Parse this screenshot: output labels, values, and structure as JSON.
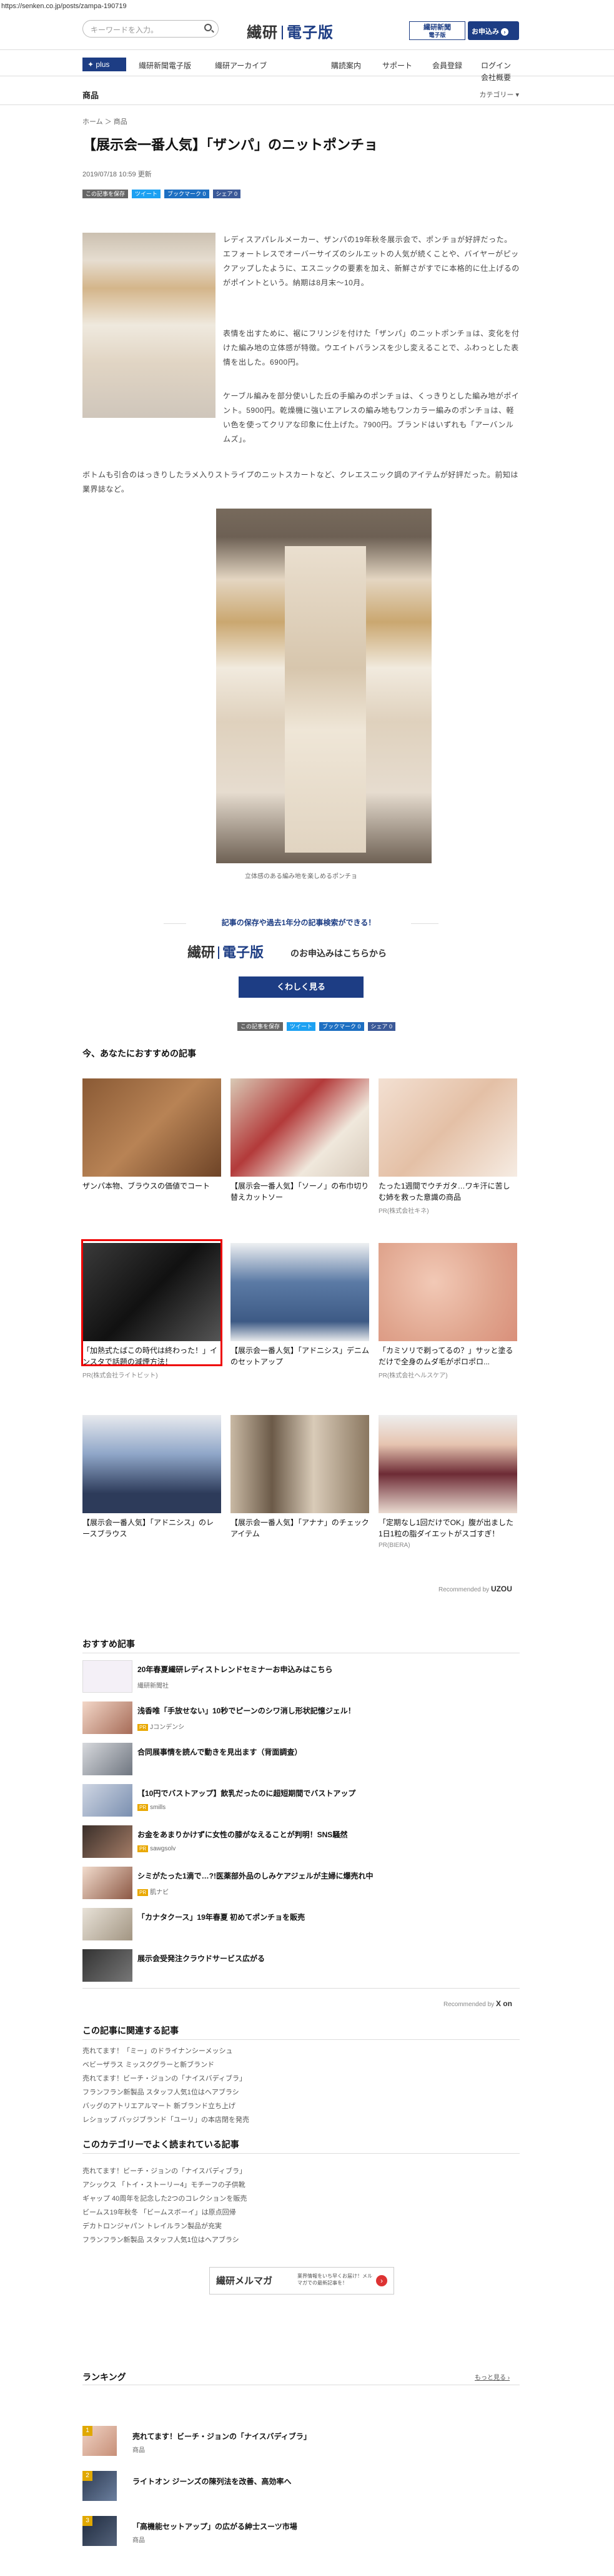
{
  "browser": {
    "url": "https://senken.co.jp/posts/zampa-190719"
  },
  "header": {
    "search_placeholder": "キーワードを入力。",
    "logo_left": "繊研",
    "logo_right": "電子版",
    "np_badge_1": "繊研新聞",
    "np_badge_2": "電子版",
    "apply_label": "お申込み"
  },
  "nav": {
    "plus": "plus",
    "items": [
      "繊研新聞電子版",
      "繊研アーカイブ",
      "購読案内",
      "サポート",
      "会員登録",
      "ログイン"
    ],
    "company": "会社概要"
  },
  "catbar": {
    "title": "商品",
    "menu": "カテゴリー ▾"
  },
  "article": {
    "breadcrumb": "ホーム ＞ 商品",
    "title": "【展示会一番人気】「ザンパ」のニットポンチョ",
    "date": "2019/07/18 10:59 更新",
    "share": {
      "hatena": "この記事を保存",
      "tweet": "ツイート",
      "bookmark": "ブックマーク 0",
      "facebook": "シェア 0"
    },
    "paragraphs": [
      "レディスアパレルメーカー、ザンパの19年秋冬展示会で、ポンチョが好評だった。エフォートレスでオーバーサイズのシルエットの人気が続くことや、バイヤーがピックアップしたように、エスニックの要素を加え、新鮮さがすでに本格的に仕上げるのがポイントという。納期は8月末～10月。",
      "表情を出すために、裾にフリンジを付けた「ザンパ」のニットポンチョは、変化を付けた編み地の立体感が特徴。ウエイトバランスを少し変えることで、ふわっとした表情を出した。6900円。",
      "ケーブル編みを部分使いした丘の手編みのポンチョは、くっきりとした編み地がポイント。5900円。乾燥機に強いエアレスの編み地もワンカラー編みのポンチョは、軽い色を使ってクリアな印象に仕上げた。7900円。ブランドはいずれも「アーバンルムズ」。",
      "ボトムも引合のはっきりしたラメ入りストライプのニットスカートなど、クレエスニック調のアイテムが好評だった。前知は業界誌など。"
    ],
    "caption": "立体感のある編み地を楽しめるポンチョ"
  },
  "promo": {
    "caption": "記事の保存や過去1年分の記事検索ができる！",
    "logo_left": "繊研",
    "logo_right": "電子版",
    "text": "のお申込みはこちらから",
    "button": "くわしく見る"
  },
  "recommend": {
    "title": "今、あなたにおすすめの記事",
    "cards": [
      {
        "title": "ザンパ本物、ブラウスの価値でコート",
        "pr": ""
      },
      {
        "title": "【展示会一番人気】「ソーノ」の布巾切り替えカットソー",
        "pr": ""
      },
      {
        "title": "たった1週間でウチガタ…ワキ汗に苦しむ姉を救った意識の商品",
        "pr": "PR(株式会社キネ)"
      },
      {
        "title": "「加熱式たばこの時代は終わった！」インスタで話題の減煙方法！",
        "pr": "PR(株式会社ライトビット)"
      },
      {
        "title": "【展示会一番人気】「アドニシス」デニムのセットアップ",
        "pr": ""
      },
      {
        "title": "「カミソリで剃ってるの？」サッと塗るだけで全身のムダ毛がポロポロ...",
        "pr": "PR(株式会社ヘルスケア)"
      },
      {
        "title": "【展示会一番人気】「アドニシス」のレースブラウス",
        "pr": ""
      },
      {
        "title": "【展示会一番人気】「アナナ」のチェックアイテム",
        "pr": ""
      },
      {
        "title": "「定期なし1回だけでOK」腹が出ました1日1粒の脂ダイエットがスゴすぎ！",
        "pr": "PR(BIERA)"
      }
    ],
    "by": "Recommended by",
    "by_logo": "UZOU"
  },
  "list": {
    "title": "おすすめ記事",
    "items": [
      {
        "title": "20年春夏繊研レディストレンドセミナーお申込みはこちら",
        "src": "繊研新聞社",
        "pr": false
      },
      {
        "title": "浅香唯「手放せない」10秒でピーンのシワ消し形状記憶ジェル！",
        "src": "Jコンデンシ",
        "pr": true
      },
      {
        "title": "合同展事情を読んで動きを見出ます（背面調査）",
        "src": "",
        "pr": false
      },
      {
        "title": "【10円でバストアップ】飲乳だったのに超短期間でバストアップ",
        "src": "smills",
        "pr": true
      },
      {
        "title": "お金をあまりかけずに女性の膝がなえることが判明！SNS騒然",
        "src": "sawgsolv",
        "pr": true
      },
      {
        "title": "シミがたった1滴で…?!医薬部外品のしみケアジェルが主婦に爆売れ中",
        "src": "肌ナビ",
        "pr": true
      },
      {
        "title": "「カナタクース」19年春夏 初めてポンチョを販売",
        "src": "",
        "pr": false
      },
      {
        "title": "展示会受発注クラウドサービス広がる",
        "src": "",
        "pr": false
      }
    ],
    "by": "Recommended by",
    "by_logo": "X on"
  },
  "related": {
    "title": "この記事に関連する記事",
    "items": [
      "売れてます！「ミー」のドライナンシーメッシュ",
      "ベビーザラス ミッスクグラーと新ブランド",
      "売れてます！ビーチ・ジョンの「ナイスバディブラ」",
      "フランフラン新製品 スタッフ人気1位はヘアブラシ",
      "バッグのアトリエアルマート 新ブランド立ち上げ",
      "レショップ バッジブランド「ユーリ」の本店閉を発売"
    ]
  },
  "category": {
    "title": "このカテゴリーでよく読まれている記事",
    "items": [
      "売れてます！ビーチ・ジョンの「ナイスバディブラ」",
      "アシックス 「トイ・ストーリー4」モチーフの子供靴",
      "ギャップ 40周年を記念した2つのコレクションを販売",
      "ビームス19年秋冬 「ビームスボーイ」は原点回帰",
      "デカトロンジャパン トレイルラン製品が充実",
      "フランフラン新製品 スタッフ人気1位はヘアブラシ"
    ]
  },
  "mailmag": {
    "logo": "繊研メルマガ",
    "sub": "業界情報をいち早くお届け！メルマガでの最新記事を！"
  },
  "ranking": {
    "title": "ランキング",
    "more": "もっと見る ›",
    "items": [
      {
        "rank": "1",
        "title": "売れてます！ビーチ・ジョンの「ナイスバディブラ」",
        "src": "商品"
      },
      {
        "rank": "2",
        "title": "ライトオン ジーンズの陳列法を改善、高効率へ",
        "src": ""
      },
      {
        "rank": "3",
        "title": "「高機能セットアップ」の広がる紳士スーツ市場",
        "src": "商品"
      }
    ]
  }
}
